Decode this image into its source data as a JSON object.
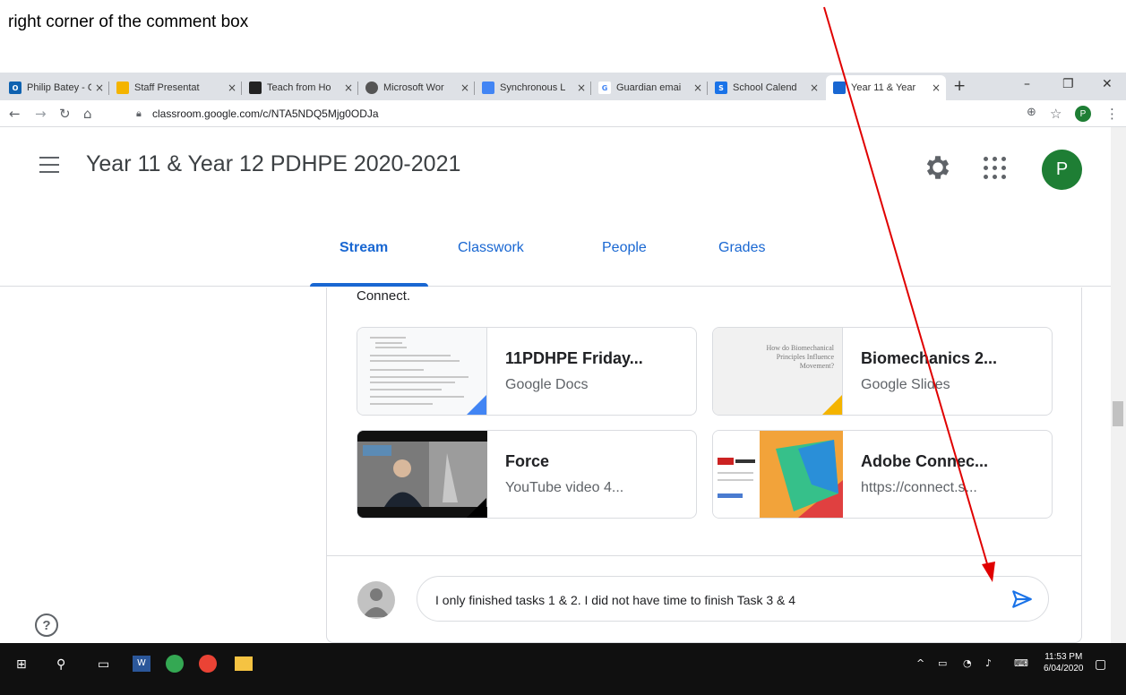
{
  "caption": "right corner of the comment box",
  "tabs": [
    {
      "label": "Philip Batey - C",
      "fav_color": "#0f62b0",
      "fav_text": "O"
    },
    {
      "label": "Staff Presentat",
      "fav_color": "#f4b400",
      "fav_text": ""
    },
    {
      "label": "Teach from Ho",
      "fav_color": "#222222",
      "fav_text": ""
    },
    {
      "label": "Microsoft Wor",
      "fav_color": "#555555",
      "fav_text": ""
    },
    {
      "label": "Synchronous L",
      "fav_color": "#4285f4",
      "fav_text": ""
    },
    {
      "label": "Guardian emai",
      "fav_color": "#ffffff",
      "fav_text": "G"
    },
    {
      "label": "School Calend",
      "fav_color": "#1a73e8",
      "fav_text": "S"
    },
    {
      "label": "Year 11 & Year",
      "fav_color": "#1967d2",
      "fav_text": ""
    }
  ],
  "address": {
    "url": "classroom.google.com/c/NTA5NDQ5Mjg0ODJa",
    "profile_letter": "P"
  },
  "classroom": {
    "title": "Year 11 & Year 12 PDHPE 2020-2021",
    "avatar_letter": "P",
    "nav": [
      "Stream",
      "Classwork",
      "People",
      "Grades"
    ]
  },
  "post": {
    "text_fragment": "Connect.",
    "attachments": [
      {
        "title": "11PDHPE Friday...",
        "type": "Google Docs"
      },
      {
        "title": "Biomechanics 2...",
        "type": "Google Slides",
        "thumb_text": "How do Biomechanical Principles Influence Movement?"
      },
      {
        "title": "Force",
        "type": "YouTube video  4..."
      },
      {
        "title": "Adobe Connec...",
        "type": "https://connect.s..."
      }
    ]
  },
  "comment": {
    "text": "I only finished tasks 1 & 2. I did not have time to finish Task 3 & 4"
  },
  "taskbar": {
    "time": "11:53 PM",
    "date": "6/04/2020"
  },
  "colors": {
    "accent": "#1967d2",
    "arrow": "#e00000"
  }
}
